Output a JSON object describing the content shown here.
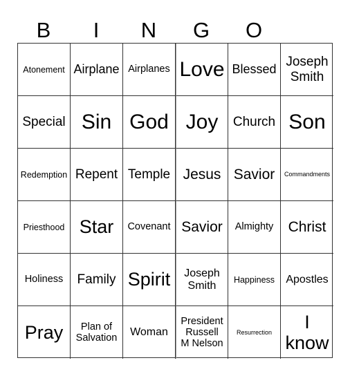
{
  "header": [
    "B",
    "I",
    "N",
    "G",
    "O"
  ],
  "cells": [
    {
      "text": "Atonement",
      "size": "s12"
    },
    {
      "text": "Airplane",
      "size": "s18"
    },
    {
      "text": "Airplanes",
      "size": "s14"
    },
    {
      "text": "Love",
      "size": "s30"
    },
    {
      "text": "Blessed",
      "size": "s18"
    },
    {
      "text": "Joseph\nSmith",
      "size": "s19"
    },
    {
      "text": "Special",
      "size": "s19"
    },
    {
      "text": "Sin",
      "size": "s30"
    },
    {
      "text": "God",
      "size": "s30"
    },
    {
      "text": "Joy",
      "size": "s30"
    },
    {
      "text": "Church",
      "size": "s19"
    },
    {
      "text": "Son",
      "size": "s30"
    },
    {
      "text": "Redemption",
      "size": "s12"
    },
    {
      "text": "Repent",
      "size": "s19"
    },
    {
      "text": "Temple",
      "size": "s19"
    },
    {
      "text": "Jesus",
      "size": "s21"
    },
    {
      "text": "Savior",
      "size": "s21"
    },
    {
      "text": "Commandments",
      "size": "s10"
    },
    {
      "text": "Priesthood",
      "size": "s12"
    },
    {
      "text": "Star",
      "size": "s27"
    },
    {
      "text": "Covenant",
      "size": "s14"
    },
    {
      "text": "Savior",
      "size": "s21"
    },
    {
      "text": "Almighty",
      "size": "s14"
    },
    {
      "text": "Christ",
      "size": "s21"
    },
    {
      "text": "Holiness",
      "size": "s14"
    },
    {
      "text": "Family",
      "size": "s19"
    },
    {
      "text": "Spirit",
      "size": "s27"
    },
    {
      "text": "Joseph\nSmith",
      "size": "s16"
    },
    {
      "text": "Happiness",
      "size": "s12"
    },
    {
      "text": "Apostles",
      "size": "s16"
    },
    {
      "text": "Pray",
      "size": "s27"
    },
    {
      "text": "Plan of\nSalvation",
      "size": "s14"
    },
    {
      "text": "Woman",
      "size": "s16"
    },
    {
      "text": "President\nRussell\nM Nelson",
      "size": "s14"
    },
    {
      "text": "Resurrection",
      "size": "s10"
    },
    {
      "text": "I\nknow",
      "size": "s27"
    }
  ]
}
